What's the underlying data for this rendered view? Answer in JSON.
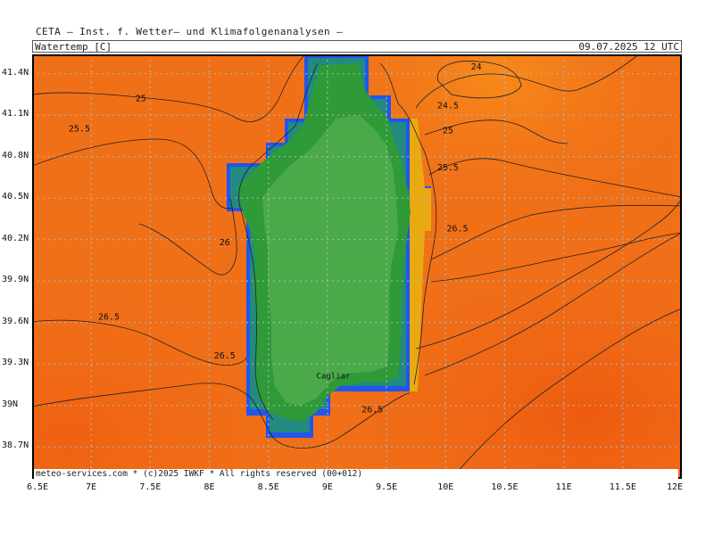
{
  "header": {
    "institute": "CETA – Inst. f. Wetter– und Klimafolgenanalysen –",
    "variable": "Watertemp_[C]",
    "valid_time": "09.07.2025 12 UTC"
  },
  "footer": {
    "credit": "meteo-services.com * (c)2025 IWKF * All rights reserved (00+012)"
  },
  "map": {
    "x_ticks": [
      "6.5E",
      "7E",
      "7.5E",
      "8E",
      "8.5E",
      "9E",
      "9.5E",
      "10E",
      "10.5E",
      "11E",
      "11.5E",
      "12E"
    ],
    "y_ticks": [
      "41.4N",
      "41.1N",
      "40.8N",
      "40.5N",
      "40.2N",
      "39.9N",
      "39.6N",
      "39.3N",
      "39N",
      "38.7N"
    ],
    "contour_labels": [
      {
        "text": "24",
        "lon": 10.26,
        "lat": 41.45
      },
      {
        "text": "24.5",
        "lon": 10.02,
        "lat": 41.17
      },
      {
        "text": "25",
        "lon": 7.42,
        "lat": 41.22
      },
      {
        "text": "25",
        "lon": 10.02,
        "lat": 40.99
      },
      {
        "text": "25.5",
        "lon": 6.9,
        "lat": 41.0
      },
      {
        "text": "25.5",
        "lon": 10.02,
        "lat": 40.72
      },
      {
        "text": "26",
        "lon": 8.13,
        "lat": 40.18
      },
      {
        "text": "26.5",
        "lon": 10.1,
        "lat": 40.28
      },
      {
        "text": "26.5",
        "lon": 7.15,
        "lat": 39.64
      },
      {
        "text": "26.5",
        "lon": 8.13,
        "lat": 39.36
      },
      {
        "text": "26.5",
        "lon": 9.38,
        "lat": 38.97
      }
    ],
    "place_labels": [
      {
        "text": "Cagliar",
        "lon": 9.05,
        "lat": 39.21
      }
    ],
    "grid": true,
    "colors": {
      "sea": "#f07018",
      "sea_warm": "#f06010",
      "sea_cool": "#f5861a",
      "land": "#4aaa4a",
      "land_dark": "#2e9a38",
      "coast_teal": "#228a80",
      "coast_blue": "#2255ee",
      "shelf_yellow": "#e8aa10",
      "grid_line": "#b0b0b0"
    }
  }
}
